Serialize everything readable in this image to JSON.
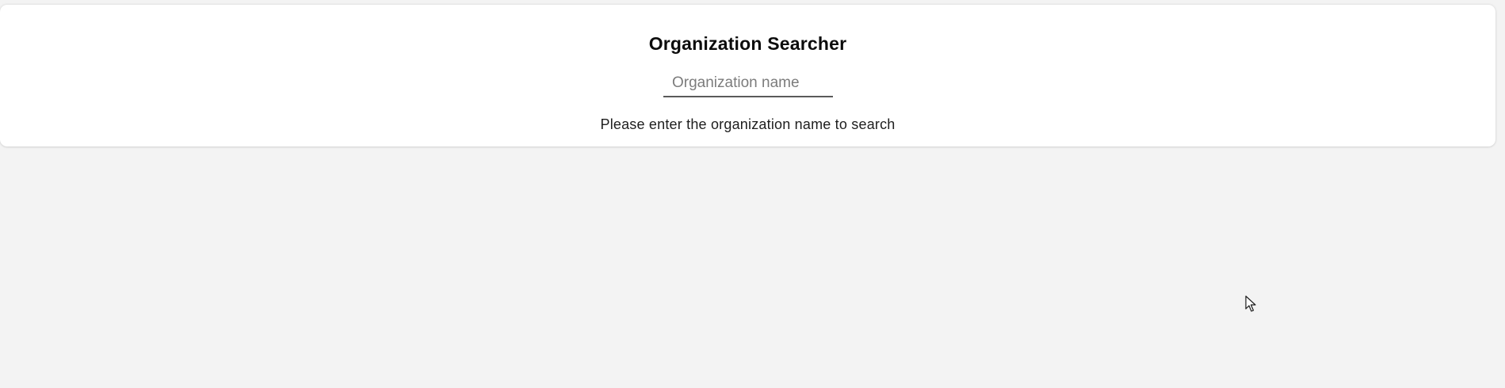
{
  "app": {
    "title": "Organization Searcher"
  },
  "search": {
    "value": "",
    "placeholder": "Organization name"
  },
  "status": {
    "message": "Please enter the organization name to search"
  },
  "colors": {
    "page_background": "#f3f3f3",
    "card_background": "#ffffff",
    "input_underline": "#5a5a5a"
  },
  "icons": {
    "cursor": "mouse-pointer-icon"
  }
}
